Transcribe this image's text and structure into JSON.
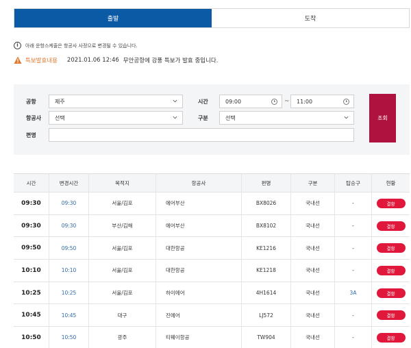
{
  "tabs": [
    {
      "label": "출발",
      "active": true
    },
    {
      "label": "도착",
      "active": false
    }
  ],
  "notice": {
    "text": "아래 운항스케줄은 항공사 사정으로 변경될 수 있습니다."
  },
  "alert": {
    "label": "특보발효내용",
    "date": "2021.01.06 12:46",
    "message": "무안공항에 강풍 특보가 발효 중입니다."
  },
  "search": {
    "airport": {
      "label": "공항",
      "value": "제주"
    },
    "airline": {
      "label": "항공사",
      "value": "선택"
    },
    "flight": {
      "label": "편명",
      "value": ""
    },
    "time": {
      "label": "시간",
      "from": "09:00",
      "to": "11:00",
      "sep": "~"
    },
    "type": {
      "label": "구분",
      "value": "선택"
    },
    "button": "조회"
  },
  "table": {
    "headers": [
      "시간",
      "변경시간",
      "목적지",
      "항공사",
      "편명",
      "구분",
      "탑승구",
      "현황"
    ],
    "rows": [
      {
        "time": "09:30",
        "changed": "09:30",
        "dest": "서울/김포",
        "airline": "에어부산",
        "flight": "BX8026",
        "type": "국내선",
        "gate": "-",
        "status": "결항"
      },
      {
        "time": "09:30",
        "changed": "09:30",
        "dest": "부산/김해",
        "airline": "에어부산",
        "flight": "BX8102",
        "type": "국내선",
        "gate": "-",
        "status": "결항"
      },
      {
        "time": "09:50",
        "changed": "09:50",
        "dest": "서울/김포",
        "airline": "대한항공",
        "flight": "KE1216",
        "type": "국내선",
        "gate": "-",
        "status": "결항"
      },
      {
        "time": "10:10",
        "changed": "10:10",
        "dest": "서울/김포",
        "airline": "대한항공",
        "flight": "KE1218",
        "type": "국내선",
        "gate": "-",
        "status": "결항"
      },
      {
        "time": "10:25",
        "changed": "10:25",
        "dest": "서울/김포",
        "airline": "하이에어",
        "flight": "4H1614",
        "type": "국내선",
        "gate": "3A",
        "status": "결항"
      },
      {
        "time": "10:45",
        "changed": "10:45",
        "dest": "대구",
        "airline": "진에어",
        "flight": "LJ572",
        "type": "국내선",
        "gate": "-",
        "status": "결항"
      },
      {
        "time": "10:50",
        "changed": "10:50",
        "dest": "광주",
        "airline": "티웨이항공",
        "flight": "TW904",
        "type": "국내선",
        "gate": "-",
        "status": "결항"
      }
    ]
  },
  "colors": {
    "tab_active": "#0b5aa6",
    "search_button": "#b0123f",
    "status_badge": "#e0193c",
    "alert_label": "#e07a2f"
  }
}
